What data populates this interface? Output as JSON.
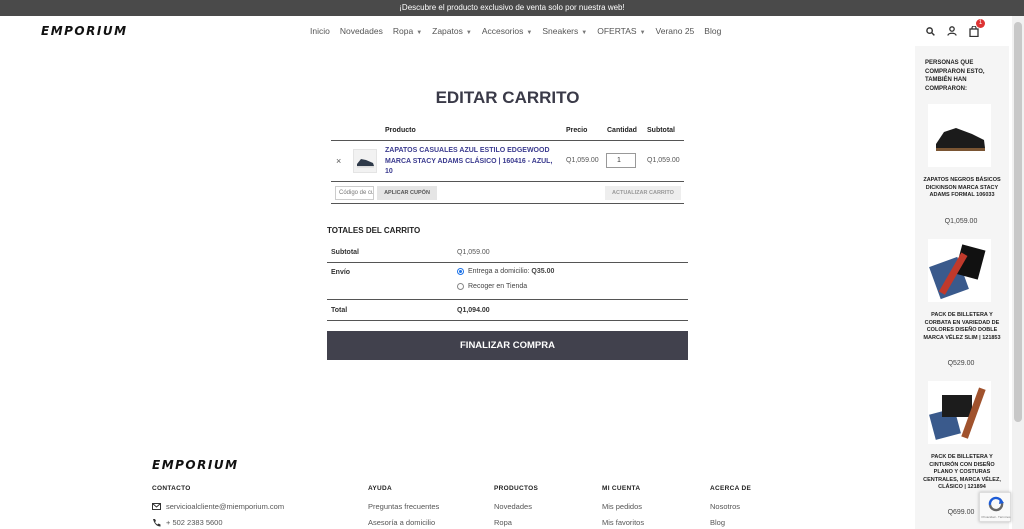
{
  "promo": {
    "text": "¡Descubre el producto exclusivo de venta solo por nuestra web!"
  },
  "brand": {
    "logo_text": "EMPORIUM"
  },
  "nav": [
    {
      "label": "Inicio",
      "has_dropdown": false
    },
    {
      "label": "Novedades",
      "has_dropdown": false
    },
    {
      "label": "Ropa",
      "has_dropdown": true
    },
    {
      "label": "Zapatos",
      "has_dropdown": true
    },
    {
      "label": "Accesorios",
      "has_dropdown": true
    },
    {
      "label": "Sneakers",
      "has_dropdown": true
    },
    {
      "label": "OFERTAS",
      "has_dropdown": true
    },
    {
      "label": "Verano 25",
      "has_dropdown": false
    },
    {
      "label": "Blog",
      "has_dropdown": false
    }
  ],
  "header_icons": {
    "search": "search-icon",
    "account": "user-icon",
    "cart": "shopping-bag-icon",
    "cart_count": "1"
  },
  "page_title": "EDITAR CARRITO",
  "cart": {
    "headers": {
      "product": "Producto",
      "price": "Precio",
      "quantity": "Cantidad",
      "subtotal": "Subtotal"
    },
    "items": [
      {
        "remove": "×",
        "name": "ZAPATOS CASUALES AZUL ESTILO EDGEWOOD MARCA STACY ADAMS CLÁSICO | 160416 - AZUL, 10",
        "price": "Q1,059.00",
        "quantity": "1",
        "subtotal": "Q1,059.00"
      }
    ],
    "coupon_placeholder": "Código de cupón",
    "apply_coupon_label": "APLICAR CUPÓN",
    "update_cart_label": "ACTUALIZAR CARRITO"
  },
  "totals": {
    "title": "TOTALES DEL CARRITO",
    "subtotal_label": "Subtotal",
    "subtotal_value": "Q1,059.00",
    "shipping_label": "Envío",
    "shipping_option_1": "Entrega a domicilio: ",
    "shipping_option_1_price": "Q35.00",
    "shipping_option_2": "Recoger en Tienda",
    "selected_shipping": "Entrega a domicilio",
    "total_label": "Total",
    "total_value": "Q1,094.00"
  },
  "checkout_label": "FINALIZAR COMPRA",
  "sidebar": {
    "title": "PERSONAS QUE COMPRARON ESTO, TAMBIÉN HAN COMPRARON:",
    "items": [
      {
        "name": "ZAPATOS NEGROS BÁSICOS DICKINSON MARCA STACY ADAMS FORMAL 106033",
        "price": "Q1,059.00"
      },
      {
        "name": "PACK DE BILLETERA Y CORBATA EN VARIEDAD DE COLORES DISEÑO DOBLE MARCA VÉLEZ SLIM | 121853",
        "price": "Q529.00"
      },
      {
        "name": "PACK DE BILLETERA Y CINTURÓN CON DISEÑO PLANO Y COSTURAS CENTRALES, MARCA VÉLEZ, CLÁSICO | 121894",
        "price": "Q699.00"
      }
    ]
  },
  "footer": {
    "contact": {
      "heading": "CONTACTO",
      "email": "servicioalcliente@miemporium.com",
      "phone": "+ 502 2383 5600"
    },
    "help": {
      "heading": "AYUDA",
      "links": [
        "Preguntas frecuentes",
        "Asesoría a domicilio"
      ]
    },
    "products": {
      "heading": "PRODUCTOS",
      "links": [
        "Novedades",
        "Ropa"
      ]
    },
    "account": {
      "heading": "MI CUENTA",
      "links": [
        "Mis pedidos",
        "Mis favoritos"
      ]
    },
    "about": {
      "heading": "ACERCA DE",
      "links": [
        "Nosotros",
        "Blog"
      ]
    }
  },
  "recaptcha": {
    "text": "Privacidad - Términos"
  },
  "colors": {
    "promo_bg": "#4a4a4a",
    "checkout_bg": "#41414d",
    "title": "#3a3a48",
    "link": "#3b3b8f",
    "badge": "#dd3333",
    "radio": "#1e73e8"
  }
}
